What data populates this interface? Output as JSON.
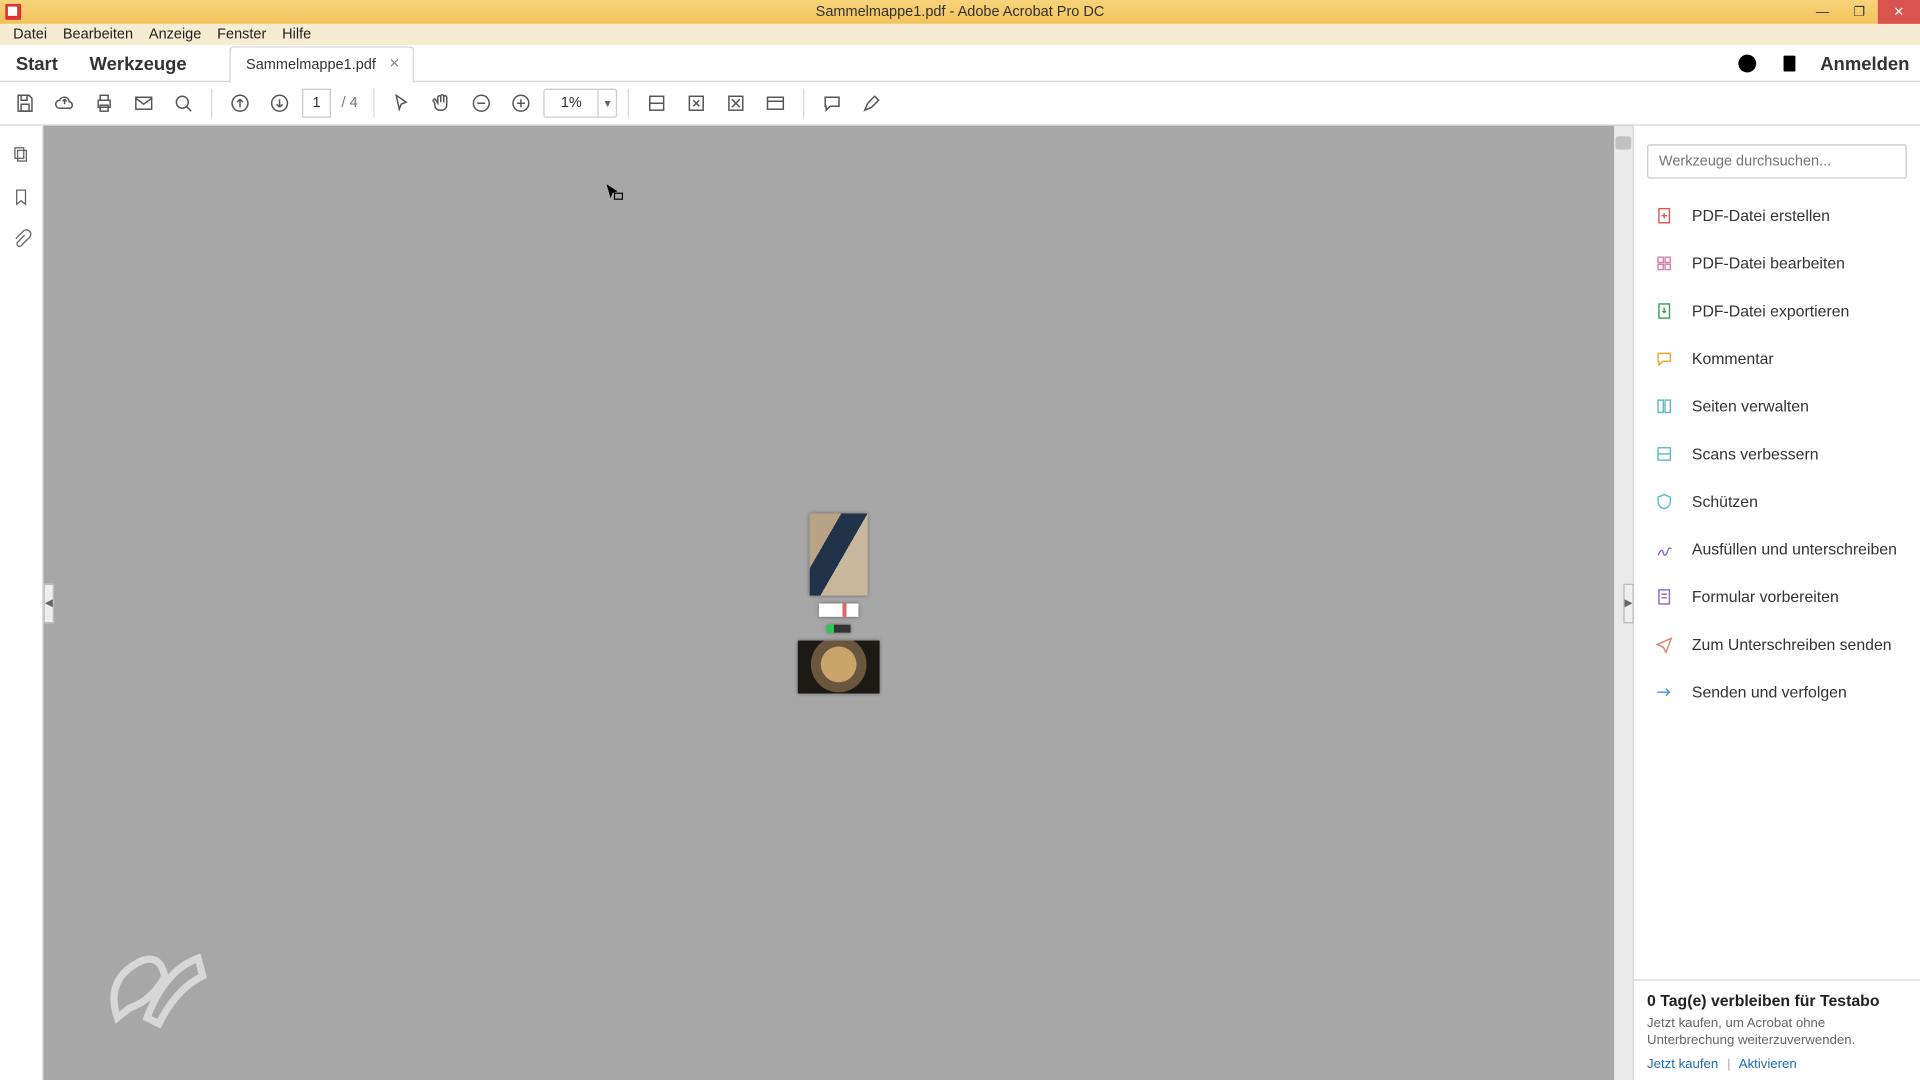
{
  "window": {
    "title": "Sammelmappe1.pdf - Adobe Acrobat Pro DC"
  },
  "menu": {
    "items": [
      "Datei",
      "Bearbeiten",
      "Anzeige",
      "Fenster",
      "Hilfe"
    ]
  },
  "tabs": {
    "home": "Start",
    "tools": "Werkzeuge",
    "doc": "Sammelmappe1.pdf",
    "signin": "Anmelden"
  },
  "toolbar": {
    "page_current": "1",
    "page_sep": "/",
    "page_total": "4",
    "zoom": "1%"
  },
  "right_panel": {
    "search_placeholder": "Werkzeuge durchsuchen...",
    "items": [
      {
        "label": "PDF-Datei erstellen",
        "icon": "create",
        "color": "#d9534f"
      },
      {
        "label": "PDF-Datei bearbeiten",
        "icon": "edit",
        "color": "#d97fa8"
      },
      {
        "label": "PDF-Datei exportieren",
        "icon": "export",
        "color": "#3b9e5f"
      },
      {
        "label": "Kommentar",
        "icon": "comment",
        "color": "#e2a93a"
      },
      {
        "label": "Seiten verwalten",
        "icon": "pages",
        "color": "#5fb8c9"
      },
      {
        "label": "Scans verbessern",
        "icon": "scan",
        "color": "#5fb8c9"
      },
      {
        "label": "Schützen",
        "icon": "shield",
        "color": "#5fb8c9"
      },
      {
        "label": "Ausfüllen und unterschreiben",
        "icon": "sign",
        "color": "#8a6bbf"
      },
      {
        "label": "Formular vorbereiten",
        "icon": "form",
        "color": "#8a6bbf"
      },
      {
        "label": "Zum Unterschreiben senden",
        "icon": "sendSign",
        "color": "#d9826b"
      },
      {
        "label": "Senden und verfolgen",
        "icon": "track",
        "color": "#4a90d9"
      }
    ]
  },
  "activation": {
    "headline": "0 Tag(e) verbleiben für Testabo",
    "sub": "Jetzt kaufen, um Acrobat ohne Unterbrechung weiterzuverwenden.",
    "buy": "Jetzt kaufen",
    "activate": "Aktivieren"
  }
}
